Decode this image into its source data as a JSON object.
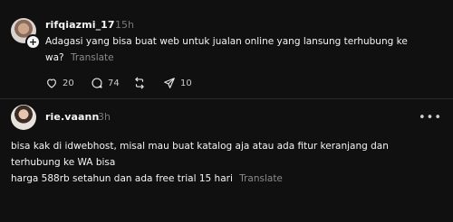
{
  "post1": {
    "username": "rifqiazmi_17",
    "time": "15h",
    "text": "Adagasi yang bisa buat web untuk jualan online yang lansung terhubung ke",
    "text_line2": "wa?",
    "translate": "Translate",
    "likes": "20",
    "replies": "74",
    "shares": "10",
    "icons": [
      "heart-icon",
      "comment-icon",
      "repost-icon",
      "share-icon",
      "follow-plus-icon"
    ]
  },
  "post2": {
    "username": "rie.vaann",
    "time": "3h",
    "lines": [
      "bisa kak di idwebhost, misal mau buat katalog aja atau ada fitur keranjang dan",
      "terhubung ke WA bisa",
      "harga 588rb setahun dan ada free trial 15 hari"
    ],
    "translate": "Translate",
    "menu": "•••"
  },
  "colors": {
    "background": "#101010",
    "text": "#f3f5f7",
    "muted": "#777777",
    "divider": "#2a2a2a"
  }
}
